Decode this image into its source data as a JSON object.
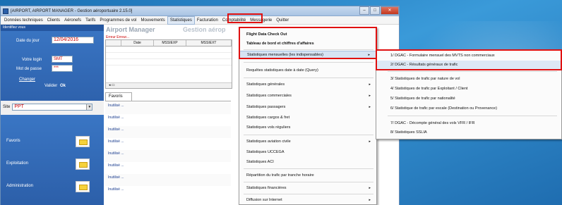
{
  "window": {
    "title": "[AIRPORT, AIRPORT MANAGER - Gestion aéroportuaire 2.15.0]",
    "minimize": "–",
    "maximize": "□",
    "close": "✕"
  },
  "menubar": [
    "Données techniques",
    "Clients",
    "Aéronefs",
    "Tarifs",
    "Programmes de vol",
    "Mouvements",
    "Statistiques",
    "Facturation",
    "Comptabilité",
    "Messagerie",
    "Quitter"
  ],
  "login": {
    "header": "Identifiez vous",
    "date_label": "Date du jour",
    "date_value": "12/04/2016",
    "login_label": "Votre login",
    "login_value": "SMT",
    "password_label": "Mot de passe",
    "password_value": "***",
    "change_link": "Changer",
    "validate_label": "Valider",
    "ok_label": "Ok"
  },
  "site": {
    "label": "Site",
    "value": "PPT"
  },
  "nav": {
    "items": [
      {
        "label": "Favoris"
      },
      {
        "label": "Exploitation"
      },
      {
        "label": "Administration"
      }
    ]
  },
  "content": {
    "brand": "Airport Manager",
    "brand2": "Gestion aérop",
    "error": "Erreur    Erreur...",
    "grid_headers": [
      "Date",
      "MSSIEXP",
      "MSSIEXT"
    ],
    "scroll_label": "◂ ▭",
    "fav_tab": "Favoris",
    "fav_items": [
      "Inutilisé ...",
      "Inutilisé ...",
      "Inutilisé ...",
      "Inutilisé ...",
      "Inutilisé ...",
      "Inutilisé ...",
      "Inutilisé ...",
      "Inutilisé ..."
    ]
  },
  "menu": {
    "items": [
      {
        "label": "Flight Data Check Out",
        "bold": true,
        "arrow": ""
      },
      {
        "label": "Tableau de bord et chiffres d'affaires",
        "bold": true,
        "arrow": ""
      },
      {
        "label": "Statistiques mensuelles (les indispensables)",
        "bold": false,
        "arrow": "▸"
      },
      {
        "label": "Requêtes statistiques date à date (Query)",
        "bold": false,
        "arrow": ""
      },
      {
        "label": "Statistiques générales",
        "bold": false,
        "arrow": "▸"
      },
      {
        "label": "Statistiques commerciales",
        "bold": false,
        "arrow": "▸"
      },
      {
        "label": "Statistiques passagers",
        "bold": false,
        "arrow": "▸"
      },
      {
        "label": "Statistiques cargos & fret",
        "bold": false,
        "arrow": ""
      },
      {
        "label": "Statistiques vols réguliers",
        "bold": false,
        "arrow": ""
      },
      {
        "label": "Statistiques aviation civile",
        "bold": false,
        "arrow": "▸"
      },
      {
        "label": "Statistiques UCCEGA",
        "bold": false,
        "arrow": ""
      },
      {
        "label": "Statistiques ACI",
        "bold": false,
        "arrow": ""
      },
      {
        "label": "Répartition du trafic par tranche horaire",
        "bold": false,
        "arrow": ""
      },
      {
        "label": "Statistiques financières",
        "bold": false,
        "arrow": "▸"
      },
      {
        "label": "Diffusion sur Internet",
        "bold": false,
        "arrow": "▸"
      }
    ]
  },
  "submenu": {
    "items": [
      "1/ DGAC - Formulaire mensuel des MVTS non commerciaux",
      "2/ DGAC - Résultats généraux de trafic",
      "3/ Statistiques de trafic par nature de vol",
      "4/ Statistiques de trafic par Exploitant / Client",
      "5/ Statistiques de trafic par nationalité",
      "6/ Statistique de trafic par escale (Destination ou Provenance)",
      "7/ DGAC - Décompte général des vols VFR / IFR",
      "8/ Statistiques SSLIA"
    ]
  }
}
